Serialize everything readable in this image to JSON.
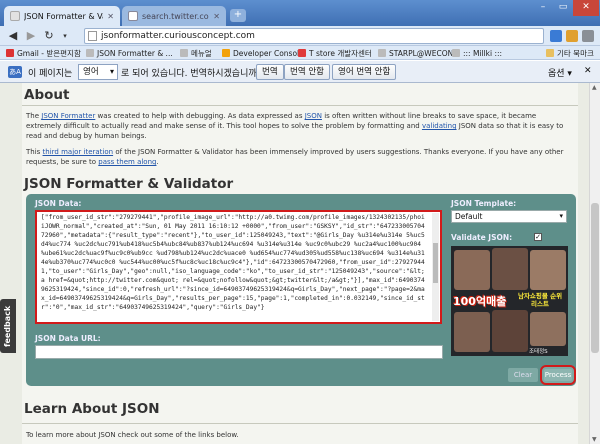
{
  "tabs": [
    {
      "label": "JSON Formatter & Validat",
      "active": true
    },
    {
      "label": "search.twitter.com/searc",
      "active": false
    }
  ],
  "url": "jsonformatter.curiousconcept.com",
  "bookmarks": [
    "Gmail - 받은편지함",
    "JSON Formatter & ...",
    "메뉴얼",
    "Developer Console",
    "T store 개발자센터",
    "STARPL@WECON",
    "::: Millki :::"
  ],
  "bookmarks_other": "기타 북마크",
  "translate_bar": {
    "prefix": "이 페이지는",
    "language": "영어",
    "suffix": "로 되어 있습니다. 번역하시겠습니까?",
    "translate_btn": "번역",
    "no_translate_btn": "번역 안함",
    "never_translate_btn": "영어 번역 안함",
    "options_label": "옵션"
  },
  "about": {
    "heading": "About",
    "p1_a": "The ",
    "p1_link1": "JSON Formatter",
    "p1_b": " was created to help with debugging. As data expressed as ",
    "p1_link2": "JSON",
    "p1_c": " is often written without line breaks to save space, it became extremely difficult to actually read and make sense of it. This tool hopes to solve the problem by formatting and ",
    "p1_link3": "validating",
    "p1_d": " JSON data so that it is easy to read and debug by human beings.",
    "p2_a": "This ",
    "p2_link1": "third major iteration",
    "p2_b": " of the JSON Formatter & Validator has been immensely improved by users suggestions. Thanks everyone. If you have any other requests, be sure to ",
    "p2_link2": "pass them along",
    "p2_c": "."
  },
  "validator": {
    "heading": "JSON Formatter & Validator",
    "json_data_label": "JSON Data:",
    "json_text": "[\"from_user_id_str\":\"279279441\",\"profile_image_url\":\"http://a0.twimg.com/profile_images/1324302135/phoiiJOWR_normal\",\"created_at\":\"Sun, 01 May 2011 16:10:12 +0000\",\"from_user\":\"GSKSY\",\"id_str\":\"64723300570472960\",\"metadata\":{\"result_type\":\"recent\"},\"to_user_id\":125049243,\"text\":\"@Girls_Day  %u314e%u314e 5%uc5d4%uc774 %uc2dc%uc791%ub418%uc5b4%ubc84%ub837%ub124%uc694 %u314e%u314e %uc9c0%ubc29 %uc2a4%uc100%uc904 %ube61%uc2dc%uac9f%uc9c0%ub9cc %ud798%ub124%uc2dc%uace0 %ud654%uc774%ud305%ud558%uc138%uc694 %u314e%u314e%ub370%uc774%uc0c0 %uc544%uc00%uc5f%uc8c%uc18c%uc9c4\"},\"id\":64723300570472960,\"from_user_id\":279279441,\"to_user\":\"Girls_Day\",\"geo\":null,\"iso_language_code\":\"ko\",\"to_user_id_str\":\"125049243\",\"source\":\"&lt;a href=&quot;http://twitter.com&quot; rel=&quot;nofollow&quot;&gt;twitter&lt;/a&gt;\"}],\"max_id\":64903749625319424,\"since_id\":0,\"refresh_url\":\"?since_id=64903749625319424&q=Girls_Day\",\"next_page\":\"?page=2&max_id=64903749625319424&q=Girls_Day\",\"results_per_page\":15,\"page\":1,\"completed_in\":0.032149,\"since_id_str\":\"0\",\"max_id_str\":\"64903749625319424\",\"query\":\"Girls_Day\"}",
    "json_url_label": "JSON Data URL:",
    "template_label": "JSON Template:",
    "template_value": "Default",
    "validate_label": "Validate JSON:",
    "ad_banner": "100억매출",
    "ad_sub": "남자쇼핑몰 순위리스트",
    "ad_foot": "조태정S",
    "clear_btn": "Clear",
    "process_btn": "Process"
  },
  "learn": {
    "heading": "Learn About JSON",
    "text": "To learn more about JSON check out some of the links below."
  },
  "feedback_label": "feedback"
}
